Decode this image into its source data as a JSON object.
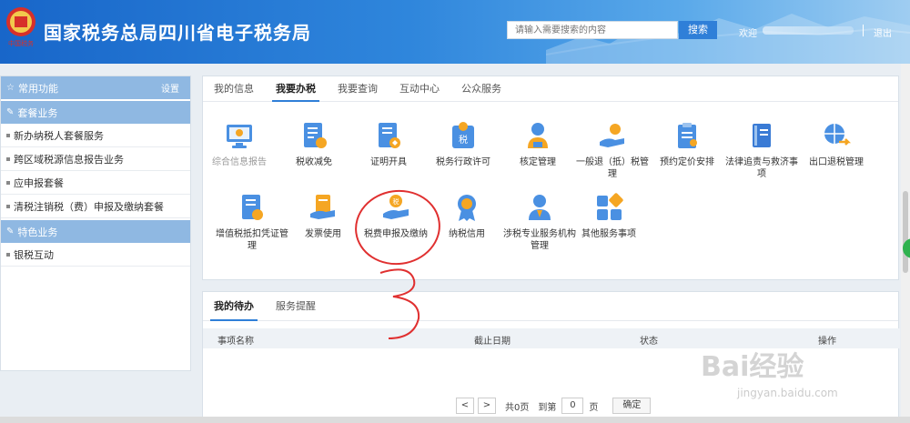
{
  "header": {
    "emblem_text": "中国税务",
    "site_title": "国家税务总局四川省电子税务局",
    "search_placeholder": "请输入需要搜索的内容",
    "search_button": "搜索",
    "welcome": "欢迎",
    "logout": "退出"
  },
  "sidebar": {
    "common": "常用功能",
    "settings": "设置",
    "package_section": "套餐业务",
    "package_items": [
      "新办纳税人套餐服务",
      "跨区域税源信息报告业务",
      "应申报套餐",
      "清税注销税（费）申报及缴纳套餐"
    ],
    "feature_section": "特色业务",
    "feature_items": [
      "银税互动"
    ]
  },
  "main": {
    "tabs": [
      "我的信息",
      "我要办税",
      "我要查询",
      "互动中心",
      "公众服务"
    ],
    "active_tab": "我要办税",
    "tiles": [
      {
        "label": "综合信息报告",
        "icon": "monitor-icon"
      },
      {
        "label": "税收减免",
        "icon": "document-reduce-icon"
      },
      {
        "label": "证明开具",
        "icon": "certificate-icon"
      },
      {
        "label": "税务行政许可",
        "icon": "tax-permit-icon"
      },
      {
        "label": "核定管理",
        "icon": "person-verify-icon"
      },
      {
        "label": "一般退（抵）税管理",
        "icon": "refund-hand-icon"
      },
      {
        "label": "预约定价安排",
        "icon": "clipboard-icon"
      },
      {
        "label": "法律追责与救济事项",
        "icon": "law-book-icon"
      },
      {
        "label": "出口退税管理",
        "icon": "globe-arrow-icon"
      },
      {
        "label": "增值税抵扣凭证管理",
        "icon": "vat-document-icon"
      },
      {
        "label": "发票使用",
        "icon": "invoice-hand-icon"
      },
      {
        "label": "税费申报及缴纳",
        "icon": "tax-pay-hand-icon"
      },
      {
        "label": "纳税信用",
        "icon": "medal-icon"
      },
      {
        "label": "涉税专业服务机构管理",
        "icon": "agent-person-icon"
      },
      {
        "label": "其他服务事项",
        "icon": "grid-blocks-icon"
      }
    ]
  },
  "todo": {
    "tabs": [
      "我的待办",
      "服务提醒"
    ],
    "columns": [
      "事项名称",
      "截止日期",
      "状态",
      "操作"
    ],
    "pager": {
      "total": "共0页",
      "goto": "到第",
      "page_value": "0",
      "page_unit": "页",
      "confirm": "确定",
      "prev": "<",
      "next": ">"
    }
  },
  "watermark": {
    "text": "Bai经验",
    "url": "jingyan.baidu.com"
  },
  "annotation": {
    "number": "3",
    "color": "#e03030"
  },
  "colors": {
    "header_blue": "#1866c9",
    "accent": "#2f7fd8",
    "sidebar_section": "#8fb8e2"
  }
}
